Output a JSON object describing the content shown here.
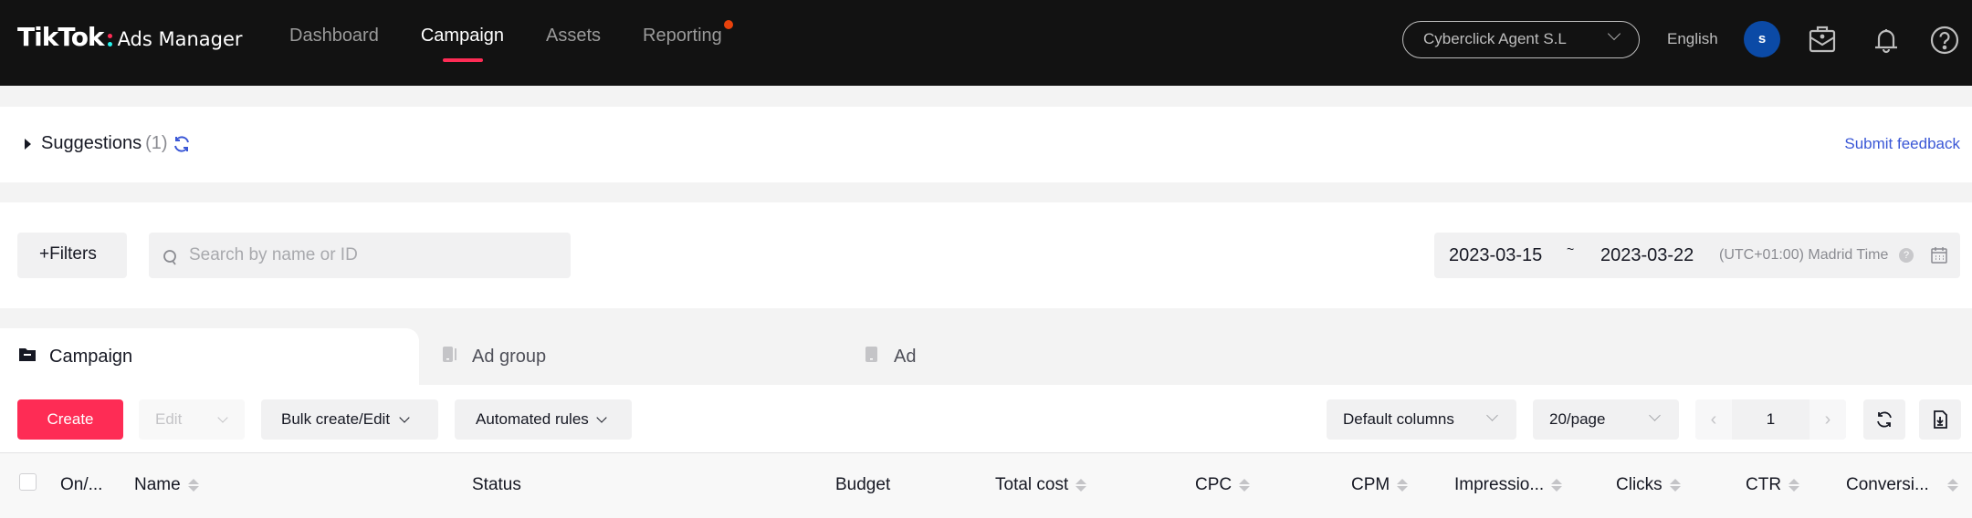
{
  "header": {
    "logo_brand": "TikTok",
    "logo_product": "Ads Manager",
    "nav": [
      {
        "label": "Dashboard",
        "active": false
      },
      {
        "label": "Campaign",
        "active": true
      },
      {
        "label": "Assets",
        "active": false
      },
      {
        "label": "Reporting",
        "active": false,
        "has_notification_dot": true
      }
    ],
    "account_selector": "Cyberclick Agent S.L",
    "language": "English",
    "avatar_initial": "s",
    "icons": [
      "briefcase-icon",
      "bell-icon",
      "help-icon"
    ],
    "colors": {
      "accent": "#fe2c55",
      "avatar": "#0b4aa6",
      "notification_dot": "#e8420c"
    }
  },
  "suggestions": {
    "title": "Suggestions",
    "count": "(1)",
    "feedback_link": "Submit feedback"
  },
  "filters": {
    "filters_button": "+Filters",
    "search_placeholder": "Search by name or ID",
    "search_value": "",
    "date_start": "2023-03-15",
    "date_separator": "~",
    "date_end": "2023-03-22",
    "timezone": "(UTC+01:00) Madrid Time"
  },
  "tabs": [
    {
      "label": "Campaign",
      "active": true
    },
    {
      "label": "Ad group",
      "active": false
    },
    {
      "label": "Ad",
      "active": false
    }
  ],
  "actions": {
    "create": "Create",
    "edit": "Edit",
    "bulk": "Bulk create/Edit",
    "rules": "Automated rules",
    "columns": "Default columns",
    "page_size": "20/page",
    "current_page": "1"
  },
  "table": {
    "columns": [
      {
        "label": "On/...",
        "sortable": false
      },
      {
        "label": "Name",
        "sortable": true
      },
      {
        "label": "Status",
        "sortable": false
      },
      {
        "label": "Budget",
        "sortable": false
      },
      {
        "label": "Total cost",
        "sortable": true
      },
      {
        "label": "CPC",
        "sortable": true
      },
      {
        "label": "CPM",
        "sortable": true
      },
      {
        "label": "Impressio...",
        "sortable": true
      },
      {
        "label": "Clicks",
        "sortable": true
      },
      {
        "label": "CTR",
        "sortable": true
      },
      {
        "label": "Conversi...",
        "sortable": true
      }
    ]
  }
}
